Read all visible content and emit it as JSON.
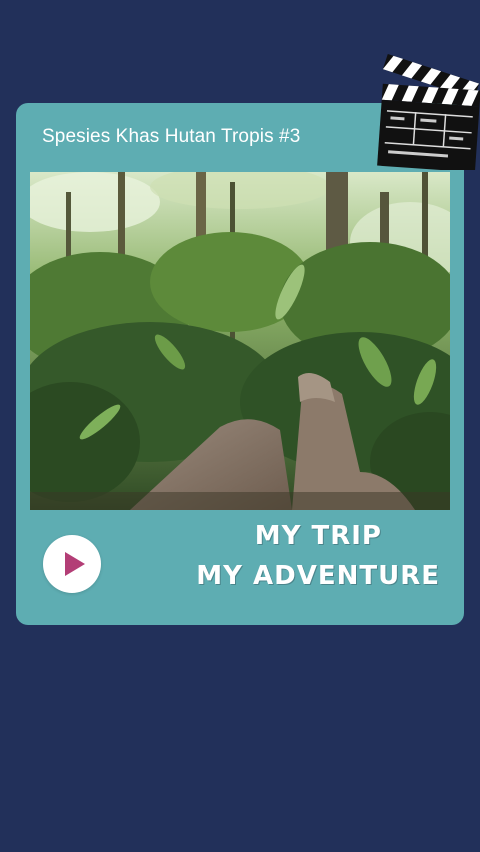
{
  "card": {
    "title": "Spesies Khas Hutan Tropis #3",
    "tagline_line1": "MY TRIP",
    "tagline_line2": "MY ADVENTURE"
  },
  "icons": {
    "play": "play-icon",
    "clapperboard": "clapperboard-icon"
  },
  "colors": {
    "background": "#22305a",
    "card": "#5eadb2",
    "play_triangle": "#b33e76"
  }
}
